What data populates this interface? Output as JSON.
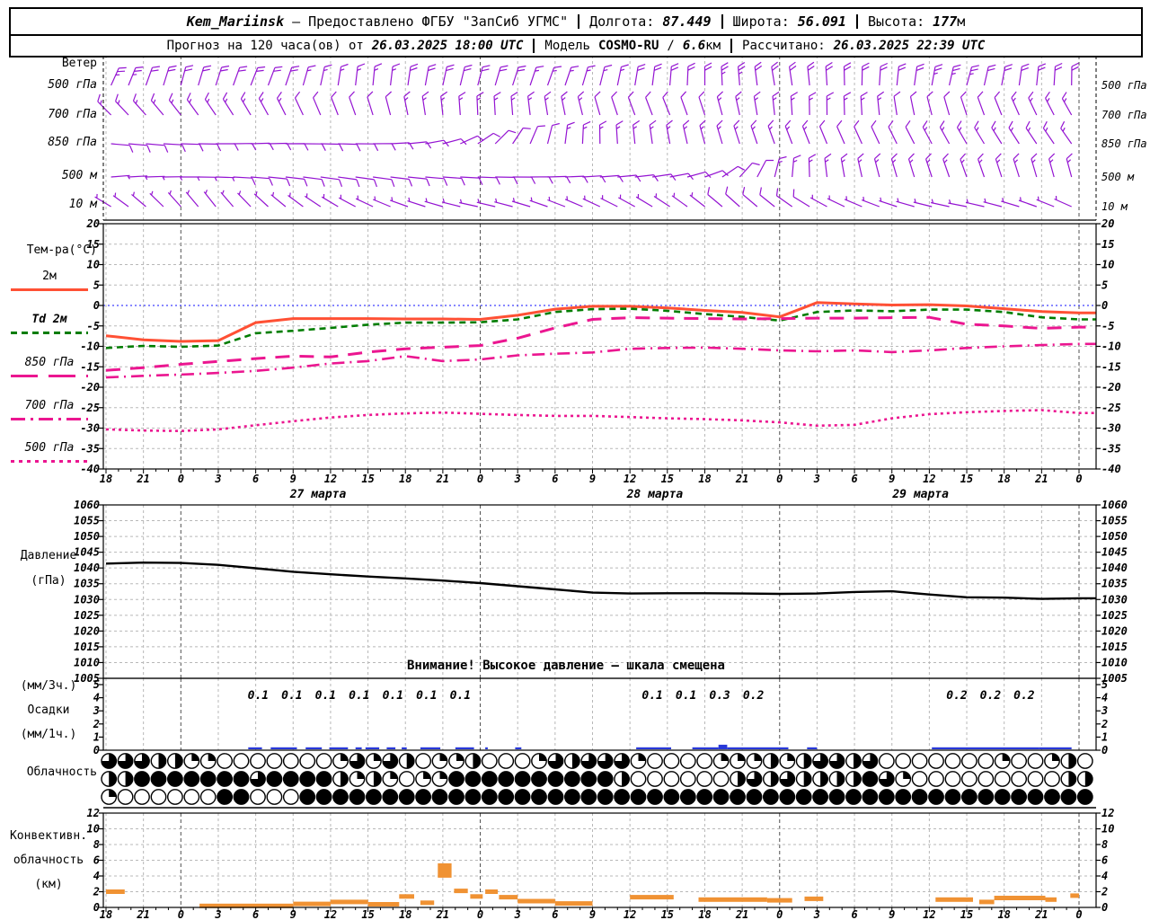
{
  "header": {
    "station": "Kem_Mariinsk",
    "dash": "—",
    "provider": "Предоставлено ФГБУ \"ЗапСиб УГМС\"",
    "lon_label": "Долгота:",
    "lon": "87.449",
    "lat_label": "Широта:",
    "lat": "56.091",
    "alt_label": "Высота:",
    "alt": "177",
    "alt_unit": "м",
    "fc_prefix": "Прогноз на 120 часа(ов) от",
    "fc_run": "26.03.2025 18:00 UTC",
    "model_label": "Модель",
    "model_name": "COSMO-RU",
    "model_slash": "/",
    "model_res": "6.6",
    "model_unit": "км",
    "calc_label": "Рассчитано:",
    "calc_time": "26.03.2025 22:39 UTC"
  },
  "warning": "Внимание! Высокое давление — шкала смещена",
  "time_axis": {
    "step_h": 3,
    "span_h": 78,
    "hours": [
      "18",
      "21",
      "0",
      "3",
      "6",
      "9",
      "12",
      "15",
      "18",
      "21",
      "0",
      "3",
      "6",
      "9",
      "12",
      "15",
      "18",
      "21",
      "0",
      "3",
      "6",
      "9",
      "12",
      "15",
      "18",
      "21",
      "0"
    ],
    "dates": [
      {
        "t": 17,
        "label": "27 марта"
      },
      {
        "t": 44,
        "label": "28 марта"
      },
      {
        "t": 65.3,
        "label": "29 марта"
      }
    ],
    "day_boundaries_t": [
      6,
      30,
      54,
      78
    ]
  },
  "colors": {
    "barb": "#9414d2",
    "t2m": "#ff5034",
    "td2m": "#007d00",
    "pink": "#eb1690",
    "zero_line": "#4040ff",
    "pressure": "#000000",
    "precip_bar": "#2838d8",
    "convective_bar": "#f09233",
    "grid": "#b8b8b8",
    "day_line": "#505050"
  },
  "chart_data": [
    {
      "id": "wind",
      "type": "barbs",
      "title": "Ветер",
      "rows": [
        {
          "level": "500 гПа",
          "y": 95,
          "dirs": [
            25,
            20,
            15,
            18,
            22,
            18,
            10,
            5,
            8,
            12,
            15,
            18,
            20,
            15,
            10,
            5,
            0,
            -5,
            -10,
            -5,
            0,
            5,
            10,
            15,
            10,
            5,
            0
          ],
          "speeds": [
            25,
            25,
            22,
            22,
            20,
            20,
            18,
            18,
            20,
            22,
            22,
            20,
            18,
            18,
            20,
            22,
            25,
            25,
            22,
            20,
            20,
            22,
            25,
            25,
            22,
            20,
            20
          ]
        },
        {
          "level": "700 гПа",
          "y": 128,
          "dirs": [
            315,
            318,
            322,
            326,
            330,
            334,
            338,
            342,
            348,
            354,
            358,
            355,
            350,
            345,
            340,
            338,
            342,
            348,
            355,
            360,
            358,
            352,
            346,
            342,
            338,
            334,
            330
          ],
          "speeds": [
            18,
            18,
            16,
            16,
            15,
            15,
            14,
            14,
            15,
            16,
            18,
            18,
            16,
            15,
            14,
            14,
            15,
            16,
            18,
            18,
            16,
            15,
            14,
            14,
            15,
            16,
            18
          ]
        },
        {
          "level": "850 гПа",
          "y": 160,
          "dirs": [
            95,
            95,
            92,
            90,
            88,
            90,
            92,
            90,
            85,
            75,
            55,
            30,
            10,
            0,
            -5,
            -10,
            -15,
            -18,
            -20,
            -22,
            -24,
            -26,
            -28,
            -30,
            -32,
            -34,
            -35
          ],
          "speeds": [
            10,
            10,
            10,
            12,
            12,
            12,
            12,
            12,
            12,
            12,
            14,
            14,
            15,
            15,
            15,
            16,
            16,
            16,
            15,
            15,
            14,
            14,
            15,
            16,
            16,
            17,
            17
          ]
        },
        {
          "level": "500 м",
          "y": 197,
          "dirs": [
            85,
            88,
            90,
            92,
            95,
            97,
            98,
            98,
            96,
            94,
            92,
            90,
            88,
            86,
            84,
            80,
            70,
            40,
            10,
            -5,
            -12,
            -16,
            -18,
            -20,
            -18,
            -16,
            -15
          ],
          "speeds": [
            8,
            8,
            8,
            10,
            10,
            10,
            10,
            10,
            10,
            10,
            10,
            10,
            10,
            10,
            12,
            12,
            12,
            14,
            16,
            18,
            18,
            16,
            16,
            15,
            15,
            16,
            16
          ]
        },
        {
          "level": "10 м",
          "y": 230,
          "dirs": [
            300,
            310,
            318,
            322,
            315,
            308,
            302,
            296,
            290,
            286,
            282,
            285,
            290,
            294,
            298,
            303,
            308,
            312,
            308,
            300,
            294,
            289,
            284,
            281,
            285,
            290,
            295
          ],
          "speeds": [
            8,
            8,
            8,
            8,
            8,
            8,
            8,
            8,
            8,
            8,
            8,
            8,
            8,
            8,
            8,
            8,
            10,
            10,
            10,
            10,
            8,
            8,
            8,
            8,
            8,
            8,
            8
          ]
        }
      ]
    },
    {
      "id": "temperature",
      "type": "line",
      "title": "Тем-ра(°C)",
      "ylim": [
        -40,
        20
      ],
      "ytick_step": 5,
      "zero_line": true,
      "series": [
        {
          "name": "2м",
          "color": "#ff5034",
          "width": 3,
          "dash": "",
          "values": [
            -7.4,
            -8.4,
            -8.8,
            -8.6,
            -4.2,
            -3.2,
            -3.2,
            -3.2,
            -3.3,
            -3.3,
            -3.4,
            -2.4,
            -0.9,
            -0.2,
            -0.2,
            -0.6,
            -1.2,
            -1.7,
            -2.8,
            0.7,
            0.4,
            0.1,
            0.2,
            -0.1,
            -0.8,
            -1.5,
            -1.8
          ]
        },
        {
          "name": "Td 2м",
          "color": "#007d00",
          "width": 2.6,
          "dash": "7,5",
          "values": [
            -10.4,
            -9.9,
            -10.1,
            -9.8,
            -6.8,
            -6.2,
            -5.5,
            -4.7,
            -4.2,
            -4.2,
            -4.1,
            -3.4,
            -1.6,
            -0.9,
            -0.8,
            -1.3,
            -2.1,
            -2.8,
            -3.7,
            -1.6,
            -1.2,
            -1.4,
            -1.0,
            -1.0,
            -1.6,
            -2.9,
            -3.4
          ]
        },
        {
          "name": "850 гПа",
          "color": "#eb1690",
          "width": 3,
          "dash": "16,11",
          "values": [
            -15.9,
            -15.2,
            -14.4,
            -13.7,
            -13.0,
            -12.4,
            -12.6,
            -11.4,
            -10.6,
            -10.2,
            -9.8,
            -8.0,
            -5.5,
            -3.4,
            -3.0,
            -3.1,
            -3.2,
            -3.3,
            -3.2,
            -3.1,
            -3.1,
            -3.0,
            -2.9,
            -4.6,
            -5.0,
            -5.6,
            -5.3
          ]
        },
        {
          "name": "700 гПа",
          "color": "#eb1690",
          "width": 2.6,
          "dash": "14,6,2,6",
          "values": [
            -17.6,
            -17.2,
            -16.9,
            -16.5,
            -16.0,
            -15.2,
            -14.2,
            -13.6,
            -12.4,
            -13.6,
            -13.2,
            -12.2,
            -11.8,
            -11.5,
            -10.6,
            -10.4,
            -10.3,
            -10.6,
            -11.0,
            -11.2,
            -11.0,
            -11.4,
            -11.0,
            -10.4,
            -10.0,
            -9.7,
            -9.4
          ]
        },
        {
          "name": "500 гПа",
          "color": "#eb1690",
          "width": 2.6,
          "dash": "3,4",
          "values": [
            -30.3,
            -30.6,
            -30.7,
            -30.3,
            -29.3,
            -28.3,
            -27.4,
            -26.8,
            -26.4,
            -26.2,
            -26.5,
            -26.8,
            -27.0,
            -27.0,
            -27.3,
            -27.6,
            -27.8,
            -28.1,
            -28.6,
            -29.4,
            -29.2,
            -27.6,
            -26.6,
            -26.1,
            -25.8,
            -25.6,
            -26.3
          ]
        }
      ]
    },
    {
      "id": "pressure",
      "type": "line",
      "ylabel_lines": [
        "Давление",
        "(гПа)"
      ],
      "ylim": [
        1005,
        1060
      ],
      "ytick_step": 5,
      "color": "#000000",
      "values": [
        1041.4,
        1041.7,
        1041.6,
        1041.0,
        1039.9,
        1038.8,
        1038.0,
        1037.3,
        1036.7,
        1036.0,
        1035.2,
        1034.2,
        1033.2,
        1032.2,
        1031.9,
        1032.0,
        1032.0,
        1031.9,
        1031.8,
        1031.9,
        1032.4,
        1032.6,
        1031.6,
        1030.7,
        1030.6,
        1030.2,
        1030.4
      ]
    },
    {
      "id": "precipitation",
      "type": "bar",
      "ylabel_lines": [
        "(мм/3ч.)",
        "Осадки",
        "(мм/1ч.)"
      ],
      "ylim": [
        0,
        5
      ],
      "ytick_step": 1,
      "labels_3h": [
        [
          12.2,
          "0.1"
        ],
        [
          14.9,
          "0.1"
        ],
        [
          17.6,
          "0.1"
        ],
        [
          20.3,
          "0.1"
        ],
        [
          23.0,
          "0.1"
        ],
        [
          25.7,
          "0.1"
        ],
        [
          28.4,
          "0.1"
        ],
        [
          43.8,
          "0.1"
        ],
        [
          46.5,
          "0.1"
        ],
        [
          49.2,
          "0.3"
        ],
        [
          51.9,
          "0.2"
        ],
        [
          68.2,
          "0.2"
        ],
        [
          70.9,
          "0.2"
        ],
        [
          73.6,
          "0.2"
        ]
      ],
      "bars_1h": [
        [
          11.4,
          12.5
        ],
        [
          13.2,
          15.3
        ],
        [
          16.0,
          17.3
        ],
        [
          17.9,
          19.4
        ],
        [
          20.0,
          20.5
        ],
        [
          20.8,
          21.9
        ],
        [
          22.5,
          23.2
        ],
        [
          23.7,
          24.1
        ],
        [
          25.2,
          26.8
        ],
        [
          28.0,
          29.5
        ],
        [
          30.4,
          30.6
        ],
        [
          32.8,
          33.3
        ],
        [
          42.5,
          45.3
        ],
        [
          47.0,
          49.1
        ],
        [
          49.1,
          49.8,
          0.35
        ],
        [
          49.8,
          54.7
        ],
        [
          56.2,
          57.0
        ],
        [
          66.2,
          74.8
        ],
        [
          74.8,
          77.4
        ]
      ]
    },
    {
      "id": "cloudiness",
      "type": "symbols",
      "title": "Облачность",
      "rows": [
        {
          "okta_quarters": "333221100000001313201120001323331000011121233230000000100120"
        },
        {
          "okta_quarters": "224444444344442121011444444444420000002323222243100000000022"
        },
        {
          "okta_quarters": "100000044000444444444444444444444444444444444444444444444444"
        }
      ]
    },
    {
      "id": "convective",
      "type": "bar",
      "ylabel_lines": [
        "Конвективн.",
        "облачность",
        "(км)"
      ],
      "ylim": [
        0,
        12
      ],
      "ytick_step": 2,
      "bars": [
        [
          0,
          1.5,
          2.0
        ],
        [
          7.5,
          15,
          0.2
        ],
        [
          15,
          18,
          0.45
        ],
        [
          18,
          21,
          0.7
        ],
        [
          21,
          23.5,
          0.4
        ],
        [
          23.5,
          24.7,
          1.4
        ],
        [
          25.2,
          26.3,
          0.6
        ],
        [
          26.6,
          27.7,
          4.7,
          16
        ],
        [
          27.9,
          29,
          2.1
        ],
        [
          29.2,
          30.2,
          1.4
        ],
        [
          30.4,
          31.4,
          2.0
        ],
        [
          31.5,
          33,
          1.3
        ],
        [
          33,
          36,
          0.8
        ],
        [
          36,
          39,
          0.5
        ],
        [
          42,
          45.5,
          1.3
        ],
        [
          47.5,
          53,
          1.0
        ],
        [
          53,
          55,
          0.9
        ],
        [
          56,
          57.5,
          1.1
        ],
        [
          66.5,
          69.5,
          1.0
        ],
        [
          70,
          71.2,
          0.7
        ],
        [
          71.2,
          75.3,
          1.2
        ],
        [
          75.3,
          76.2,
          1.0
        ],
        [
          77.3,
          78,
          1.5
        ]
      ]
    }
  ]
}
